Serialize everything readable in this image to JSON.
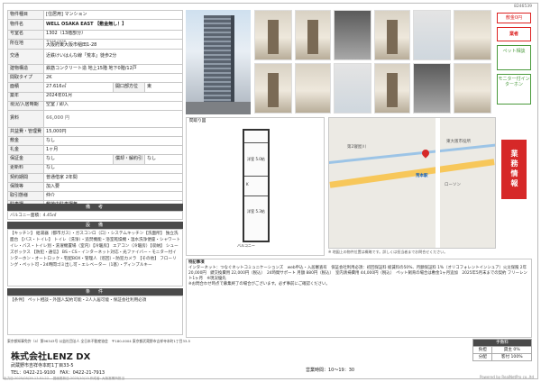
{
  "doc_id": "8246539",
  "specs": {
    "type_label": "物件種目",
    "type_value": "[住居用] マンション",
    "name_label": "物件名",
    "name_value": "WELL OSAKA EAST 【敷金無し！】",
    "room_label": "号室名",
    "room_value": "1302（13階部分）",
    "address_label": "所在地",
    "address_zip": "〒578-0936",
    "address_value": "大阪府東大阪市稲田1-28",
    "traffic_label": "交通",
    "traffic_value": "近鉄けいはんな線「荒本」徒歩2分",
    "structure_label": "建物構造",
    "structure_value": "鉄筋コンクリート造 地上15階 地下0階/12戸",
    "layout_label": "間取タイプ",
    "layout_value": "2K",
    "area_label": "面積",
    "area_value": "27.616㎡",
    "direction_label": "開口部方位",
    "direction_value": "東",
    "built_label": "築年",
    "built_value": "2024年01月",
    "status_label": "現況/入居時期",
    "status_value": "空室 / 即入",
    "rent_label": "賃料",
    "rent_value": "66,000 円",
    "mgmt_label": "共益費・管理費",
    "mgmt_value": "15,000円",
    "deposit_label": "敷金",
    "deposit_value": "なし",
    "key_label": "礼金",
    "key_value": "1ヶ月",
    "guarantee_label": "保証金",
    "guarantee_value": "なし",
    "amort_label": "償却・解約引",
    "amort_value": "なし",
    "renewal_label": "更新料",
    "renewal_value": "なし",
    "contract_label": "契約期間",
    "contract_value": "普通借家 2年間",
    "insurance_label": "保険等",
    "insurance_value": "加入要",
    "trade_label": "取引態様",
    "trade_value": "仲介",
    "parking_label": "駐車場",
    "parking_value": "敷地内駐車場無"
  },
  "sections": {
    "balcony_head": "備　考",
    "balcony_text": "バルコニー面積：4.45㎡",
    "facility_head": "設　備",
    "facility_text": "【キッチン】 給湯器（都市ガス）・ガスコンロ（口）・システムキッチン【洗面所】 独立洗面台 【バス・トイレ】 トイレ（洗浄）・追焚機能・浴室乾燥機・温水洗浄便座・シャワートイレ・バス・トイレ別・洗濯機置場（室内）【冷暖房】 エアコン（冷暖房）【収納】 シューズボックス 【防犯・通信】 BS・CS・インターネット対応・光ファイバー・モニター付インターホン・オートロック・宅配BOX・管理人（巡回）・防犯カメラ 【その他】 フローリング・ペット可・24時間ゴミ出し可・エレベーター（1基）・ディンプルキー",
    "conditions_head": "条　件",
    "conditions_text": "【条件】 ペット相談・外国人契約可能・2人入居可能・保証会社利用必須"
  },
  "badges": {
    "shikikin": "敷金0円",
    "gyousha": "業者",
    "pet": "ペット相談",
    "model": "モニター付インターホン"
  },
  "side_tab": "業務情報",
  "plan": {
    "title": "間取り図",
    "room1": "洋室 5.0帖",
    "room2": "洋室 5.3帖",
    "kitchen": "K",
    "balcony": "バルコニー"
  },
  "map": {
    "station": "荒本駅",
    "label_1": "東大阪市役所",
    "label_2": "ローソン",
    "label_3": "第2寝屋川",
    "note": "※ 地図上の物件位置は概略です。詳しくは担当者までお問合せください。"
  },
  "remarks": {
    "title": "特記事項",
    "text": "インターネット：つなぐネットコミュニケーションズ　web申込・入居審査有　保証会社利用必須：初回保証料 総賃料の50%、月額保証料 1%（オリコフォレントインシュア）火災保険 2年 20,000円　鍵交換費用 22,000円（税込）　24時間サポート 月額 880円（税込）　室内清掃費用 44,000円（税込）　ペット飼育の場合は敷金1ヶ月追加　2025年5月末までの契約 フリーレント1ヶ月　※現況優先",
    "contact_line": "※お問合わせ時点で募集終了の場合がございます。必ず事前にご確認ください。"
  },
  "footer": {
    "note": "東京都知事免許（4）第96343号 公益社団法人 全日本不動産協会　〒180-0004 東京都武蔵野市吉祥寺本町1丁目33-5",
    "company": "株式会社LENZ DX",
    "address": "武蔵野市吉祥寺本町1丁目33-5",
    "tel": "TEL：0422-21-9100　FAX：0422-21-7913",
    "hours": "営業時間：10〜19：30",
    "printed": "出力日:2025/05/29 17:51:22 　図面更新日:2025/10/13 作成者: 大阪営業所担当",
    "powered": "Powered by RealNetPro co.,ltd"
  },
  "fee_table": {
    "head": "手数料",
    "row1_label": "負担",
    "row1_value": "貸主 0%",
    "row2_label": "分配",
    "row2_value": "客付 100%"
  }
}
